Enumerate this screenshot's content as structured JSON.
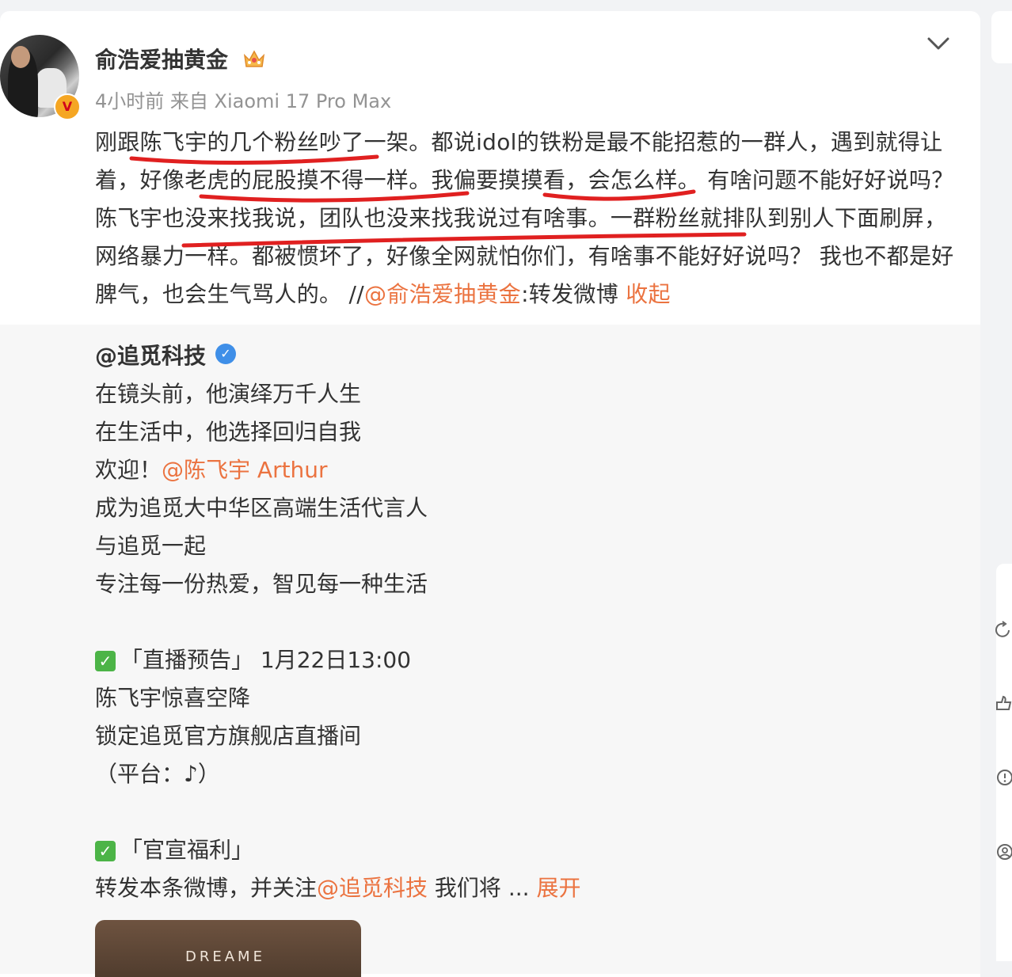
{
  "post": {
    "username": "俞浩爱抽黄金",
    "meta": "4小时前 来自 Xiaomi 17 Pro Max",
    "avatar_badge": "V",
    "text_1": "刚跟陈飞宇的几个粉丝吵了一架。都说idol的铁粉是最不能招惹的一群人，遇到就得让着，好像老虎的屁股摸不得一样。我偏要摸摸看，会怎么样。 有啥问题不能好好说吗？陈飞宇也没来找我说，团队也没来找我说过有啥事。一群粉丝就排队到别人下面刷屏，网络暴力一样。都被惯坏了，好像全网就怕你们，有啥事不能好好说吗？ 我也不都是好脾气，也会生气骂人的。 //",
    "mention": "@俞浩爱抽黄金",
    "text_2": ":转发微博 ",
    "collapse": "收起"
  },
  "repost": {
    "author": "@追觅科技",
    "author_badge": "✓",
    "line1": "在镜头前，他演绎万千人生",
    "line2": "在生活中，他选择回归自我",
    "line3_a": "欢迎！",
    "line3_mention": "@陈飞宇 Arthur",
    "line4": "成为追觅大中华区高端生活代言人",
    "line5": "与追觅一起",
    "line6": "专注每一份热爱，智见每一种生活",
    "check": "✓",
    "live_title": "「直播预告」 1月22日13:00",
    "live1": "陈飞宇惊喜空降",
    "live2": "锁定追觅官方旗舰店直播间",
    "live3": "（平台：♪）",
    "welfare_title": "「官宣福利」",
    "welfare_a": "转发本条微博，并关注",
    "welfare_mention": "@追觅科技",
    "welfare_b": " 我们将 ... ",
    "expand": "展开",
    "thumb_text": "DREAME"
  },
  "colors": {
    "accent": "#eb7340",
    "underline": "#e02020",
    "repost_bg": "#f7f7f7"
  }
}
